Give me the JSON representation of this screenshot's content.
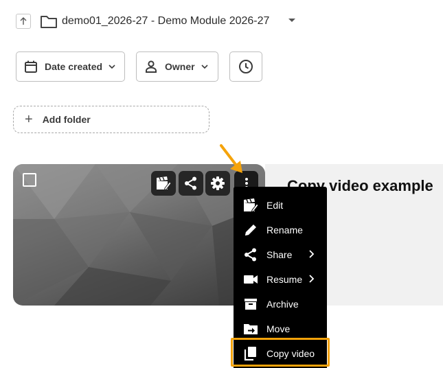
{
  "breadcrumb": {
    "title": "demo01_2026-27 - Demo Module 2026-27",
    "up_icon": "arrow-up-icon",
    "folder_icon": "folder-icon",
    "dropdown_icon": "caret-down-icon"
  },
  "filters": {
    "date_label": "Date created",
    "owner_label": "Owner",
    "history_icon": "clock-icon"
  },
  "add_folder": {
    "label": "Add folder"
  },
  "video": {
    "title": "Copy video example",
    "toolbar_icons": [
      "edit-video-icon",
      "share-icon",
      "gear-icon",
      "more-vertical-icon"
    ]
  },
  "menu": {
    "items": [
      {
        "label": "Edit",
        "icon": "edit-video-icon",
        "submenu": false
      },
      {
        "label": "Rename",
        "icon": "pencil-icon",
        "submenu": false
      },
      {
        "label": "Share",
        "icon": "share-icon",
        "submenu": true
      },
      {
        "label": "Resume",
        "icon": "video-camera-icon",
        "submenu": true
      },
      {
        "label": "Archive",
        "icon": "archive-icon",
        "submenu": false
      },
      {
        "label": "Move",
        "icon": "move-folder-icon",
        "submenu": false
      },
      {
        "label": "Copy video",
        "icon": "copy-icon",
        "submenu": false,
        "highlighted": true
      }
    ]
  },
  "colors": {
    "highlight": "#f5a30a",
    "menu_bg": "#000000",
    "info_panel_bg": "#f1f1f1"
  }
}
